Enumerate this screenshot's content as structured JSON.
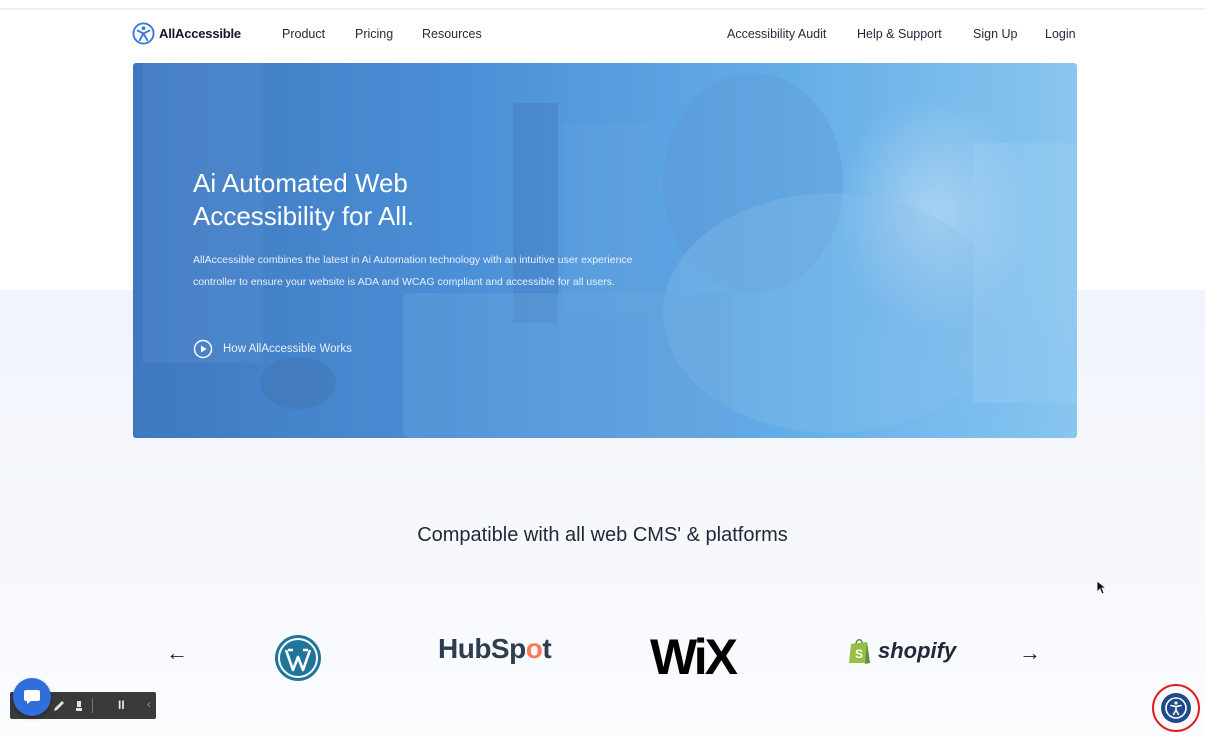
{
  "header": {
    "logo_text_bold": "All",
    "logo_text_rest": "Accessible",
    "nav_left": [
      "Product",
      "Pricing",
      "Resources"
    ],
    "nav_right": [
      "Accessibility Audit",
      "Help & Support",
      "Sign Up",
      "Login"
    ]
  },
  "hero": {
    "title_line1": "Ai Automated Web",
    "title_line2": "Accessibility for All.",
    "desc_line1": "AllAccessible combines the latest in Ai Automation technology with an intuitive user experience",
    "desc_line2": "controller to ensure your website is ADA and WCAG compliant and accessible for all users.",
    "cta_label": "How AllAccessible Works"
  },
  "compat": {
    "title": "Compatible with all web CMS' & platforms",
    "prev_arrow": "←",
    "next_arrow": "→",
    "brands": {
      "hubspot_a": "HubSp",
      "hubspot_o": "o",
      "hubspot_b": "t",
      "wix": "WiX",
      "shopify": "shopify"
    }
  },
  "icons": {
    "logo": "allaccessible-logo-icon",
    "play": "play-circle-icon",
    "wordpress": "wordpress-logo-icon",
    "shopify": "shopify-bag-icon",
    "chat": "chat-bubble-icon",
    "pencil": "pencil-icon",
    "highlighter": "highlighter-icon",
    "pause": "pause-icon",
    "collapse": "chevron-left-icon",
    "accessibility": "accessibility-icon"
  },
  "colors": {
    "brand_blue": "#2f6fdd",
    "hero_blue": "#4b8fd6",
    "wordpress_blue": "#21759b",
    "hubspot_orange": "#ff7a59",
    "shopify_green": "#95bf47",
    "highlight_red": "#e02020"
  },
  "toolbar": {
    "pause_glyph": "II",
    "collapse_glyph": "‹"
  }
}
